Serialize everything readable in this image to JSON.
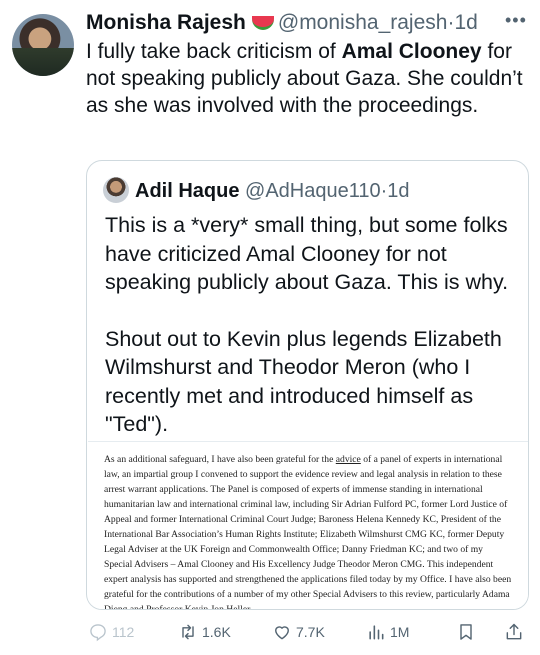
{
  "tweet": {
    "name": "Monisha Rajesh",
    "emoji_icon": "watermelon-icon",
    "handle": "@monisha_rajesh",
    "dot": "·",
    "time": "1d",
    "text_1": "I fully take back criticism of ",
    "text_bold": "Amal Clooney",
    "text_2": " for not speaking publicly about Gaza. She couldn’t as she was involved with the proceedings."
  },
  "quote": {
    "name": "Adil Haque",
    "handle": "@AdHaque110",
    "dot": "·",
    "time": "1d",
    "para_1": "This is a *very* small thing, but some folks have criticized Amal Clooney for not speaking publicly about Gaza. This is why.",
    "para_2": "Shout out to Kevin plus legends Elizabeth Wilmshurst and Theodor Meron (who I recently met and introduced himself as \"Ted\").",
    "doc": {
      "pre": "As an additional safeguard, I have also been grateful for the ",
      "link": "advice",
      "post": " of a panel of experts in international law, an impartial group I convened to support the evidence review and legal analysis in relation to these arrest warrant applications. The Panel is composed of experts of immense standing in international humanitarian law and international criminal law, including  Sir Adrian Fulford PC, former Lord Justice of Appeal and former International Criminal Court Judge; Baroness Helena Kennedy KC, President of the International Bar Association’s Human Rights Institute; Elizabeth Wilmshurst CMG KC, former Deputy Legal Adviser at the UK Foreign and Commonwealth Office; Danny Friedman KC; and two of my Special Advisers – Amal Clooney and His Excellency Judge Theodor Meron CMG. This independent expert analysis has supported and strengthened the applications filed today by my Office. I have also been grateful for the contributions of a number of my other Special Advisers to this review, particularly Adama Dieng and Professor Kevin Jon Heller."
    }
  },
  "actions": {
    "replies": "112",
    "reposts": "1.6K",
    "likes": "7.7K",
    "views": "1M"
  },
  "colors": {
    "text": "#0f1419",
    "secondary": "#536471",
    "border": "#cfd9de"
  }
}
